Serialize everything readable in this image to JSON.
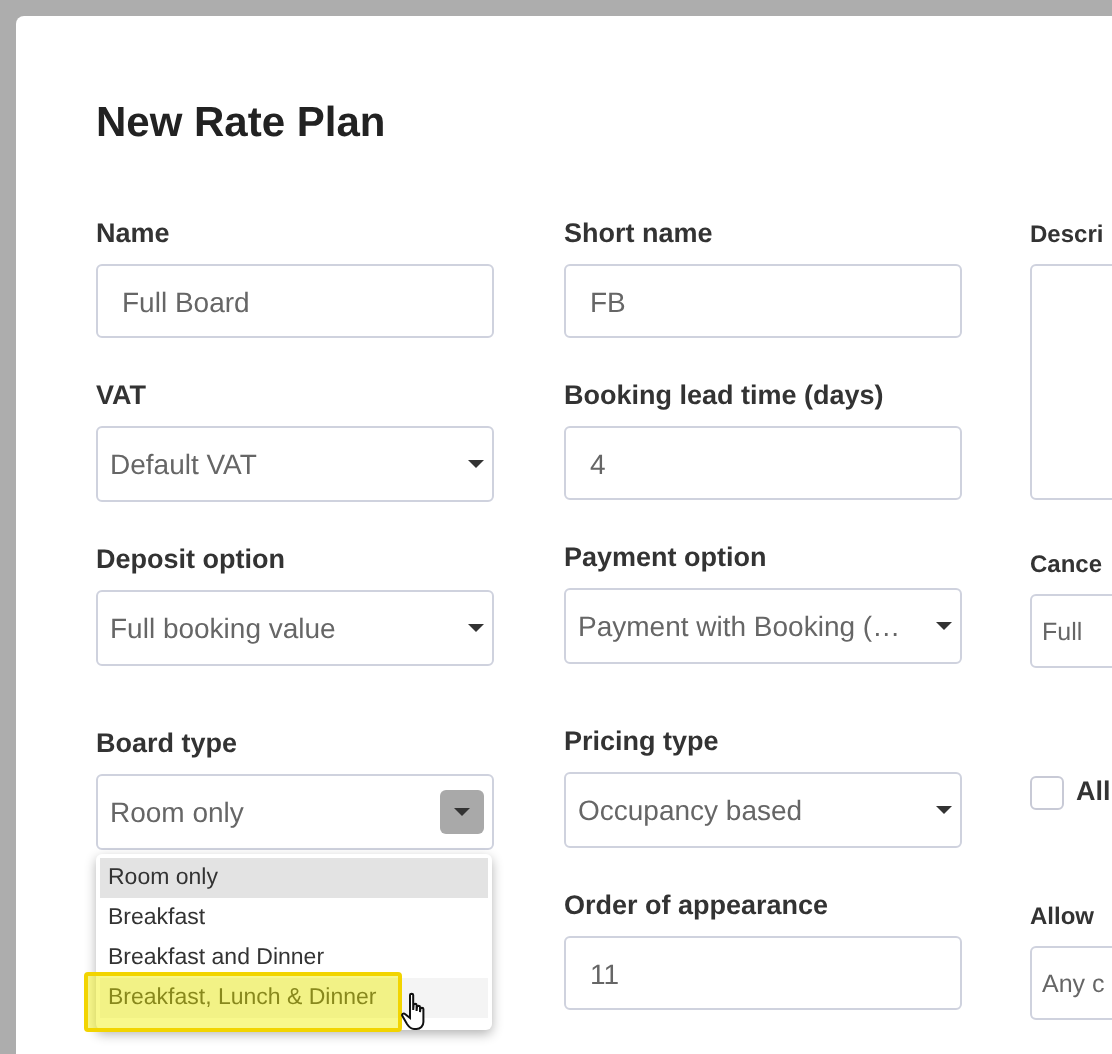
{
  "dialog": {
    "title": "New Rate Plan"
  },
  "columns": [
    [
      {
        "kind": "input",
        "label": "Name",
        "value": "Full Board"
      },
      {
        "kind": "select",
        "label": "VAT",
        "value": "Default VAT"
      },
      {
        "kind": "select",
        "label": "Deposit option",
        "value": "Full booking value"
      },
      {
        "kind": "select",
        "label": "Board type",
        "value": "Room only",
        "open": true,
        "options": [
          {
            "label": "Room only",
            "selected": true,
            "highlighted": false
          },
          {
            "label": "Breakfast",
            "selected": false,
            "highlighted": false
          },
          {
            "label": "Breakfast and Dinner",
            "selected": false,
            "highlighted": false
          },
          {
            "label": "Breakfast, Lunch & Dinner",
            "selected": false,
            "highlighted": true
          }
        ]
      }
    ],
    [
      {
        "kind": "input",
        "label": "Short name",
        "value": "FB"
      },
      {
        "kind": "input",
        "label": "Booking lead time (days)",
        "value": "4"
      },
      {
        "kind": "select",
        "label": "Payment option",
        "value": "Payment with Booking (…"
      },
      {
        "kind": "select",
        "label": "Pricing type",
        "value": "Occupancy based"
      },
      {
        "kind": "input",
        "label": "Order of appearance",
        "value": "11"
      }
    ],
    [
      {
        "kind": "textarea",
        "label": "Descri"
      },
      {
        "kind": "input",
        "label": "Cance",
        "value": "Full"
      },
      {
        "kind": "checkbox",
        "label": "All",
        "checked": false
      },
      {
        "kind": "input",
        "label": "Allow",
        "value": "Any c"
      }
    ]
  ]
}
